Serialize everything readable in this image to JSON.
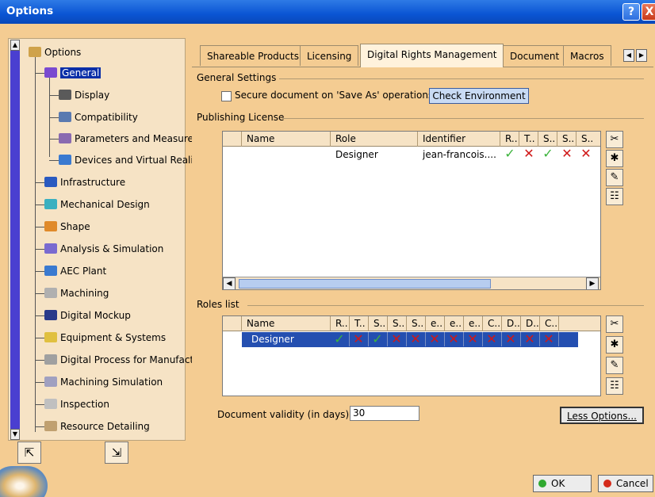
{
  "window": {
    "title": "Options",
    "help_icon": "?",
    "close_icon": "X"
  },
  "tree": {
    "items": [
      {
        "label": "Options",
        "icon": "options-icon"
      },
      {
        "label": "General",
        "icon": "general-icon",
        "selected": true
      },
      {
        "label": "Display",
        "icon": "display-icon"
      },
      {
        "label": "Compatibility",
        "icon": "compatibility-icon"
      },
      {
        "label": "Parameters and Measure",
        "icon": "parameters-icon"
      },
      {
        "label": "Devices and Virtual Reality",
        "icon": "devices-icon"
      },
      {
        "label": "Infrastructure",
        "icon": "infrastructure-icon"
      },
      {
        "label": "Mechanical Design",
        "icon": "mechanical-design-icon"
      },
      {
        "label": "Shape",
        "icon": "shape-icon"
      },
      {
        "label": "Analysis & Simulation",
        "icon": "analysis-icon"
      },
      {
        "label": "AEC Plant",
        "icon": "aec-plant-icon"
      },
      {
        "label": "Machining",
        "icon": "machining-icon"
      },
      {
        "label": "Digital Mockup",
        "icon": "digital-mockup-icon"
      },
      {
        "label": "Equipment & Systems",
        "icon": "equipment-icon"
      },
      {
        "label": "Digital Process for Manufacturing",
        "icon": "digital-process-icon"
      },
      {
        "label": "Machining Simulation",
        "icon": "machining-simulation-icon"
      },
      {
        "label": "Inspection",
        "icon": "inspection-icon"
      },
      {
        "label": "Resource Detailing",
        "icon": "resource-detailing-icon"
      }
    ]
  },
  "tabs": [
    {
      "label": "Shareable Products"
    },
    {
      "label": "Licensing"
    },
    {
      "label": "Digital Rights Management",
      "active": true
    },
    {
      "label": "Document"
    },
    {
      "label": "Macros"
    }
  ],
  "general_settings": {
    "title": "General Settings",
    "secure_label": "Secure document on 'Save As' operations",
    "secure_checked": false,
    "check_env_label": "Check Environment"
  },
  "publishing_license": {
    "title": "Publishing License",
    "columns": [
      "Name",
      "Role",
      "Identifier",
      "R..",
      "T..",
      "S..",
      "S..",
      "S.."
    ],
    "rows": [
      {
        "name": "",
        "role": "Designer",
        "identifier": "jean-francois....",
        "flags": [
          true,
          false,
          true,
          false,
          false
        ]
      }
    ]
  },
  "roles_list": {
    "title": "Roles list",
    "columns": [
      "Name",
      "R..",
      "T..",
      "S..",
      "S..",
      "S..",
      "e..",
      "e..",
      "e..",
      "C..",
      "D..",
      "D..",
      "C.."
    ],
    "rows": [
      {
        "name": "Designer",
        "flags": [
          true,
          false,
          true,
          false,
          false,
          false,
          false,
          false,
          false,
          false,
          false,
          false
        ]
      }
    ]
  },
  "validity": {
    "label": "Document validity (in days) :",
    "value": "30"
  },
  "less_options_label": "Less Options...",
  "footer": {
    "ok_label": "OK",
    "cancel_label": "Cancel"
  },
  "colors": {
    "ok_dot": "#2fa82f",
    "cancel_dot": "#d42a1a",
    "selection": "#244fb0"
  }
}
